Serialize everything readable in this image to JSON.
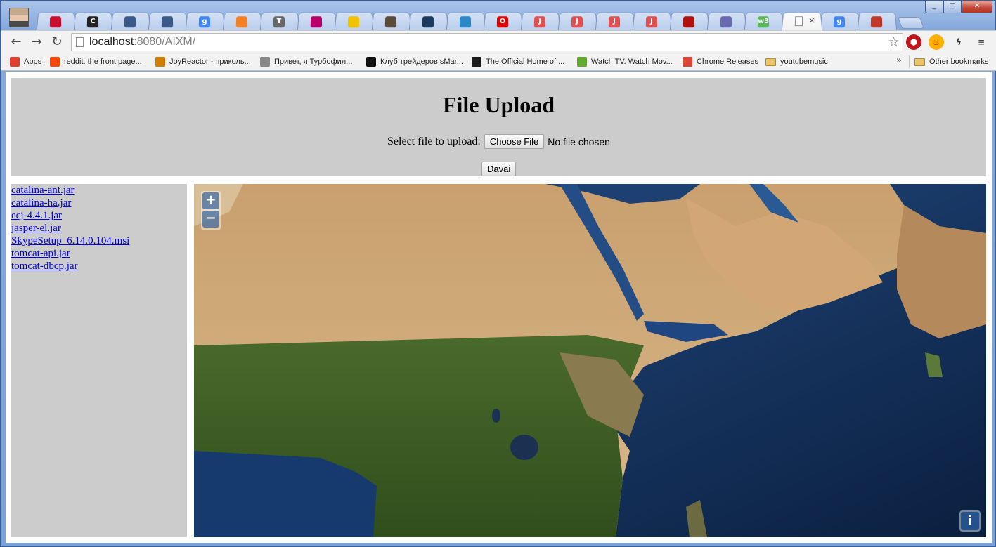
{
  "window": {
    "controls": {
      "minimize": "_",
      "maximize": "□",
      "close": "✕"
    }
  },
  "tabs": [
    {
      "icon": "maryland-flag-icon",
      "color": "#c8102e",
      "glyph": ""
    },
    {
      "icon": "c-logo-icon",
      "color": "#222222",
      "glyph": "C"
    },
    {
      "icon": "cube-icon",
      "color": "#3b5a8a",
      "glyph": ""
    },
    {
      "icon": "cube-icon",
      "color": "#3b5a8a",
      "glyph": ""
    },
    {
      "icon": "google-icon",
      "color": "#4285f4",
      "glyph": "g"
    },
    {
      "icon": "stackoverflow-icon",
      "color": "#f48024",
      "glyph": ""
    },
    {
      "icon": "t-letter-icon",
      "color": "#666666",
      "glyph": "T"
    },
    {
      "icon": "feather-icon",
      "color": "#b5006b",
      "glyph": ""
    },
    {
      "icon": "yellow-frame-icon",
      "color": "#f2c200",
      "glyph": ""
    },
    {
      "icon": "instagram-icon",
      "color": "#5a4a3a",
      "glyph": ""
    },
    {
      "icon": "photo-icon",
      "color": "#1c3a5e",
      "glyph": ""
    },
    {
      "icon": "network-icon",
      "color": "#2a8ac8",
      "glyph": ""
    },
    {
      "icon": "oracle-icon",
      "color": "#e00000",
      "glyph": "O"
    },
    {
      "icon": "j-letter-icon",
      "color": "#e05050",
      "glyph": "J"
    },
    {
      "icon": "j-letter-icon",
      "color": "#e05050",
      "glyph": "J"
    },
    {
      "icon": "j-letter-icon",
      "color": "#e05050",
      "glyph": "J"
    },
    {
      "icon": "j-letter-icon",
      "color": "#e05050",
      "glyph": "J"
    },
    {
      "icon": "bug-icon",
      "color": "#b01010",
      "glyph": ""
    },
    {
      "icon": "diamond-icon",
      "color": "#6a6ab0",
      "glyph": ""
    },
    {
      "icon": "w3-icon",
      "color": "#5cb85c",
      "glyph": "w3"
    },
    {
      "icon": "blank-page-icon",
      "color": "#ffffff",
      "glyph": "",
      "active": true
    },
    {
      "icon": "google-icon",
      "color": "#4285f4",
      "glyph": "g"
    },
    {
      "icon": "blocks-icon",
      "color": "#c0392b",
      "glyph": ""
    }
  ],
  "toolbar": {
    "url_host": "localhost",
    "url_rest": ":8080/AIXM/"
  },
  "bookmarks": [
    {
      "label": "Apps",
      "icon": "apps-grid-icon",
      "color": "#e04030"
    },
    {
      "label": "reddit: the front page...",
      "icon": "reddit-icon",
      "color": "#ff4500"
    },
    {
      "label": "JoyReactor - приколь...",
      "icon": "joyreactor-icon",
      "color": "#d08000"
    },
    {
      "label": "Привет, я Турбофил...",
      "icon": "turbofilm-icon",
      "color": "#888888"
    },
    {
      "label": "Клуб трейдеров sMar...",
      "icon": "smart-lab-icon",
      "color": "#111111"
    },
    {
      "label": "The Official Home of ...",
      "icon": "official-home-icon",
      "color": "#1a1a1a"
    },
    {
      "label": "Watch TV. Watch Mov...",
      "icon": "hulu-icon",
      "color": "#66aa33"
    },
    {
      "label": "Chrome Releases",
      "icon": "chrome-icon",
      "color": "#db4437"
    },
    {
      "label": "youtubemusic",
      "icon": "folder-icon",
      "color": "#e9c46a"
    }
  ],
  "bookmarks_overflow": "»",
  "other_bookmarks": "Other bookmarks",
  "page": {
    "title": "File Upload",
    "select_label": "Select file to upload:",
    "choose_button": "Choose File",
    "no_file": "No file chosen",
    "submit_button": "Davai",
    "files": [
      "catalina-ant.jar",
      "catalina-ha.jar",
      "ecj-4.4.1.jar",
      "jasper-el.jar",
      "SkypeSetup_6.14.0.104.msi",
      "tomcat-api.jar",
      "tomcat-dbcp.jar"
    ],
    "map": {
      "zoom_in": "+",
      "zoom_out": "−",
      "info": "i"
    }
  }
}
